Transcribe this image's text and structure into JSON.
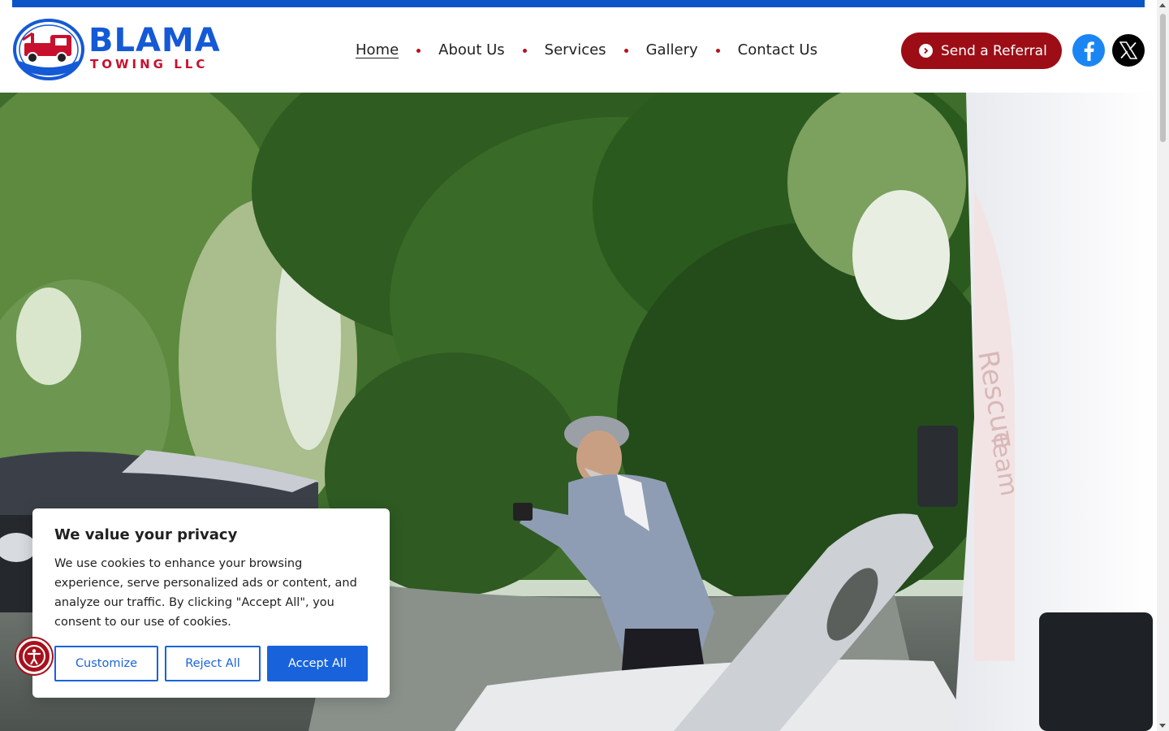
{
  "brand": {
    "name": "BLAMA",
    "subtitle": "TOWING LLC",
    "primary_color": "#1459d6",
    "accent_color": "#c8102e"
  },
  "nav": {
    "items": [
      {
        "label": "Home",
        "active": true
      },
      {
        "label": "About Us",
        "active": false
      },
      {
        "label": "Services",
        "active": false
      },
      {
        "label": "Gallery",
        "active": false
      },
      {
        "label": "Contact Us",
        "active": false
      }
    ]
  },
  "header": {
    "referral_label": "Send a Referral",
    "referral_icon": "chevron-right-circle-icon",
    "social": [
      "facebook-icon",
      "x-twitter-icon"
    ]
  },
  "hero": {
    "image": "man-photographing-car-accident-next-to-tow-truck",
    "truck_text": [
      "Rescue",
      "Team"
    ]
  },
  "cookie": {
    "title": "We value your privacy",
    "text": "We use cookies to enhance your browsing experience, serve personalized ads or content, and analyze our traffic. By clicking \"Accept All\", you consent to our use of cookies.",
    "customize_label": "Customize",
    "reject_label": "Reject All",
    "accept_label": "Accept All",
    "button_color": "#1863dc"
  },
  "accessibility": {
    "icon": "accessibility-icon"
  }
}
